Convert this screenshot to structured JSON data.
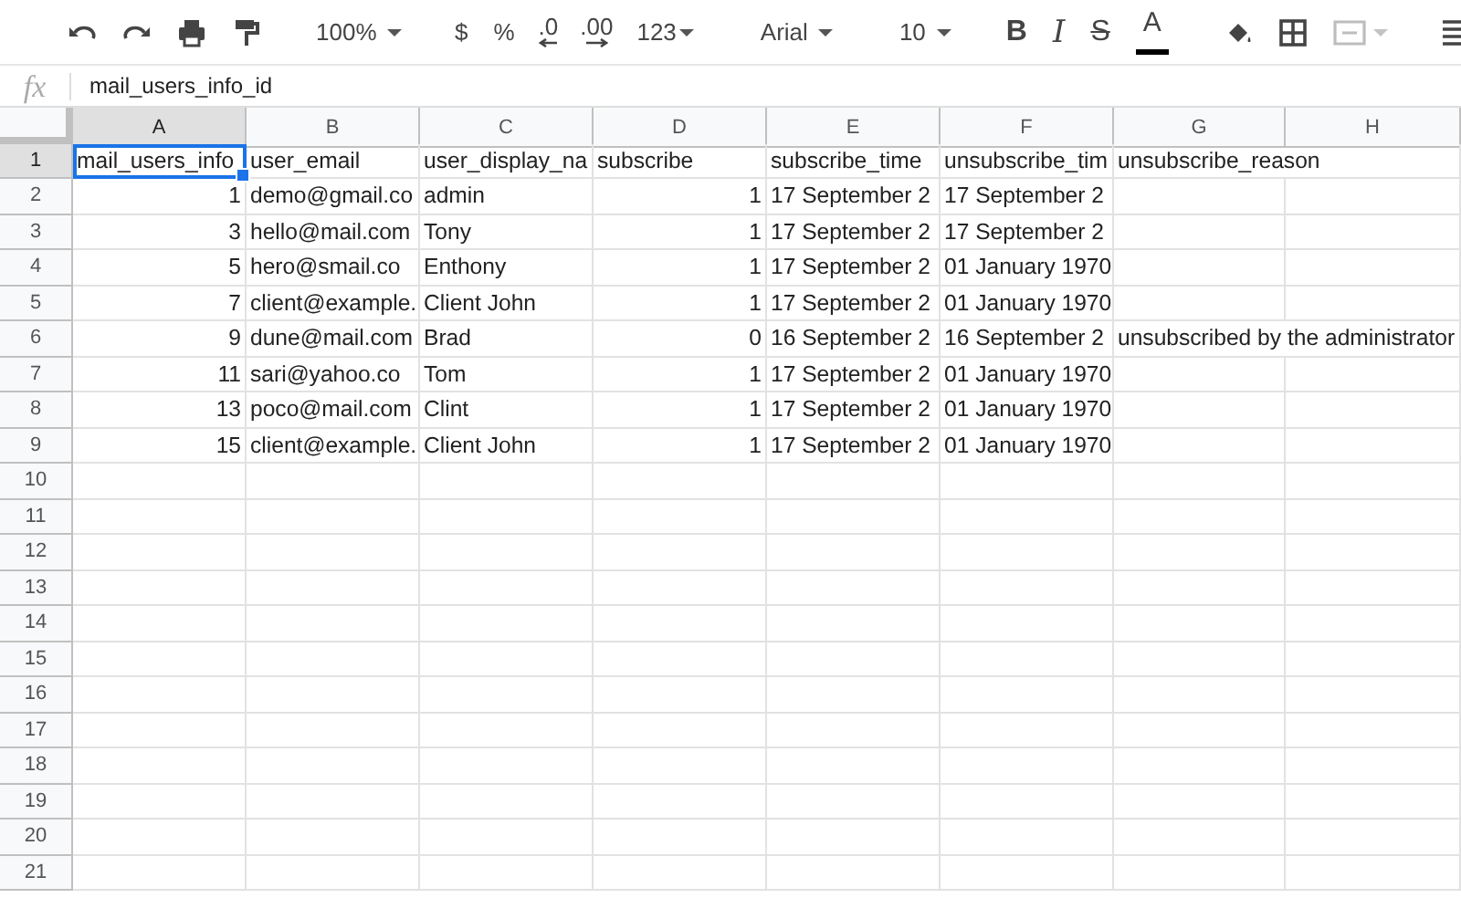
{
  "toolbar": {
    "zoom": "100%",
    "currency": "$",
    "percent": "%",
    "decrease_decimal": ".0",
    "increase_decimal": ".00",
    "more_formats": "123",
    "font": "Arial",
    "font_size": "10",
    "bold": "B",
    "italic": "I",
    "strikethrough": "S",
    "text_color": "A",
    "merge_cells": {
      "disabled": true
    }
  },
  "formula_bar": {
    "label": "fx",
    "value": "mail_users_info_id"
  },
  "grid": {
    "columns": [
      {
        "label": "A",
        "selected": true,
        "numeric": true
      },
      {
        "label": "B",
        "selected": false,
        "numeric": false
      },
      {
        "label": "C",
        "selected": false,
        "numeric": false
      },
      {
        "label": "D",
        "selected": false,
        "numeric": true
      },
      {
        "label": "E",
        "selected": false,
        "numeric": false
      },
      {
        "label": "F",
        "selected": false,
        "numeric": false
      },
      {
        "label": "G",
        "selected": false,
        "numeric": false
      },
      {
        "label": "H",
        "selected": false,
        "numeric": false
      }
    ],
    "rows": [
      {
        "number": "1",
        "selected": true,
        "kind": "header",
        "last_cell_spans": true,
        "cells": [
          "mail_users_info",
          "user_email",
          "user_display_na",
          "subscribe",
          "subscribe_time",
          "unsubscribe_tim",
          "unsubscribe_reason"
        ]
      },
      {
        "number": "2",
        "selected": false,
        "kind": "data",
        "cells": [
          "1",
          "demo@gmail.co",
          "admin",
          "1",
          "17 September 2",
          "17 September 2"
        ]
      },
      {
        "number": "3",
        "selected": false,
        "kind": "data",
        "cells": [
          "3",
          "hello@mail.com",
          "Tony",
          "1",
          "17 September 2",
          "17 September 2"
        ]
      },
      {
        "number": "4",
        "selected": false,
        "kind": "data",
        "cells": [
          "5",
          "hero@smail.co",
          "Enthony",
          "1",
          "17 September 2",
          "01 January 1970"
        ]
      },
      {
        "number": "5",
        "selected": false,
        "kind": "data",
        "cells": [
          "7",
          "client@example.",
          "Client John",
          "1",
          "17 September 2",
          "01 January 1970"
        ]
      },
      {
        "number": "6",
        "selected": false,
        "kind": "data",
        "last_cell_spans": true,
        "cells": [
          "9",
          "dune@mail.com",
          "Brad",
          "0",
          "16 September 2",
          "16 September 2",
          "unsubscribed by the administrator"
        ]
      },
      {
        "number": "7",
        "selected": false,
        "kind": "data",
        "cells": [
          "11",
          "sari@yahoo.co",
          "Tom",
          "1",
          "17 September 2",
          "01 January 1970"
        ]
      },
      {
        "number": "8",
        "selected": false,
        "kind": "data",
        "cells": [
          "13",
          "poco@mail.com",
          "Clint",
          "1",
          "17 September 2",
          "01 January 1970"
        ]
      },
      {
        "number": "9",
        "selected": false,
        "kind": "data",
        "cells": [
          "15",
          "client@example.",
          "Client John",
          "1",
          "17 September 2",
          "01 January 1970"
        ]
      },
      {
        "number": "10",
        "selected": false,
        "kind": "data",
        "cells": []
      },
      {
        "number": "11",
        "selected": false,
        "kind": "data",
        "cells": []
      },
      {
        "number": "12",
        "selected": false,
        "kind": "data",
        "cells": []
      },
      {
        "number": "13",
        "selected": false,
        "kind": "data",
        "cells": []
      },
      {
        "number": "14",
        "selected": false,
        "kind": "data",
        "cells": []
      },
      {
        "number": "15",
        "selected": false,
        "kind": "data",
        "cells": []
      },
      {
        "number": "16",
        "selected": false,
        "kind": "data",
        "cells": []
      },
      {
        "number": "17",
        "selected": false,
        "kind": "data",
        "cells": []
      },
      {
        "number": "18",
        "selected": false,
        "kind": "data",
        "cells": []
      },
      {
        "number": "19",
        "selected": false,
        "kind": "data",
        "cells": []
      },
      {
        "number": "20",
        "selected": false,
        "kind": "data",
        "cells": []
      },
      {
        "number": "21",
        "selected": false,
        "kind": "data",
        "cells": []
      }
    ]
  }
}
